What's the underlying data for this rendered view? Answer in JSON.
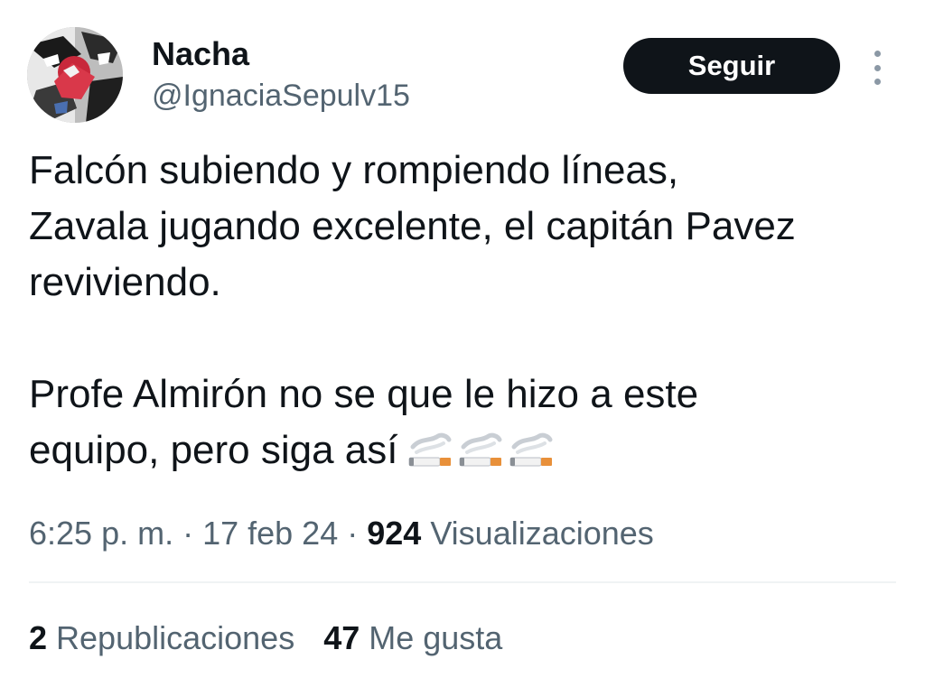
{
  "user": {
    "display_name": "Nacha",
    "handle": "@IgnaciaSepulv15"
  },
  "follow_button": {
    "label": "Seguir"
  },
  "more_menu": {
    "icon": "more-vertical-icon"
  },
  "tweet": {
    "line1": "Falcón subiendo y rompiendo líneas,",
    "line2": "Zavala jugando excelente, el capitán Pavez",
    "line3": "reviviendo.",
    "line4": "Profe Almirón no se que le hizo a este",
    "line5": "equipo, pero siga así",
    "emojis": [
      "cigarette-emoji",
      "cigarette-emoji",
      "cigarette-emoji"
    ]
  },
  "meta": {
    "time": "6:25 p. m.",
    "sep1": " · ",
    "date": "17 feb 24",
    "sep2": " · ",
    "views_count": "924",
    "views_label": " Visualizaciones"
  },
  "stats": {
    "reposts_count": "2",
    "reposts_label": " Republicaciones",
    "likes_count": "47",
    "likes_label": " Me gusta"
  },
  "colors": {
    "text_primary": "#0f1419",
    "text_secondary": "#536471",
    "button_bg": "#0f1419",
    "button_text": "#ffffff",
    "divider": "#eff3f4"
  }
}
